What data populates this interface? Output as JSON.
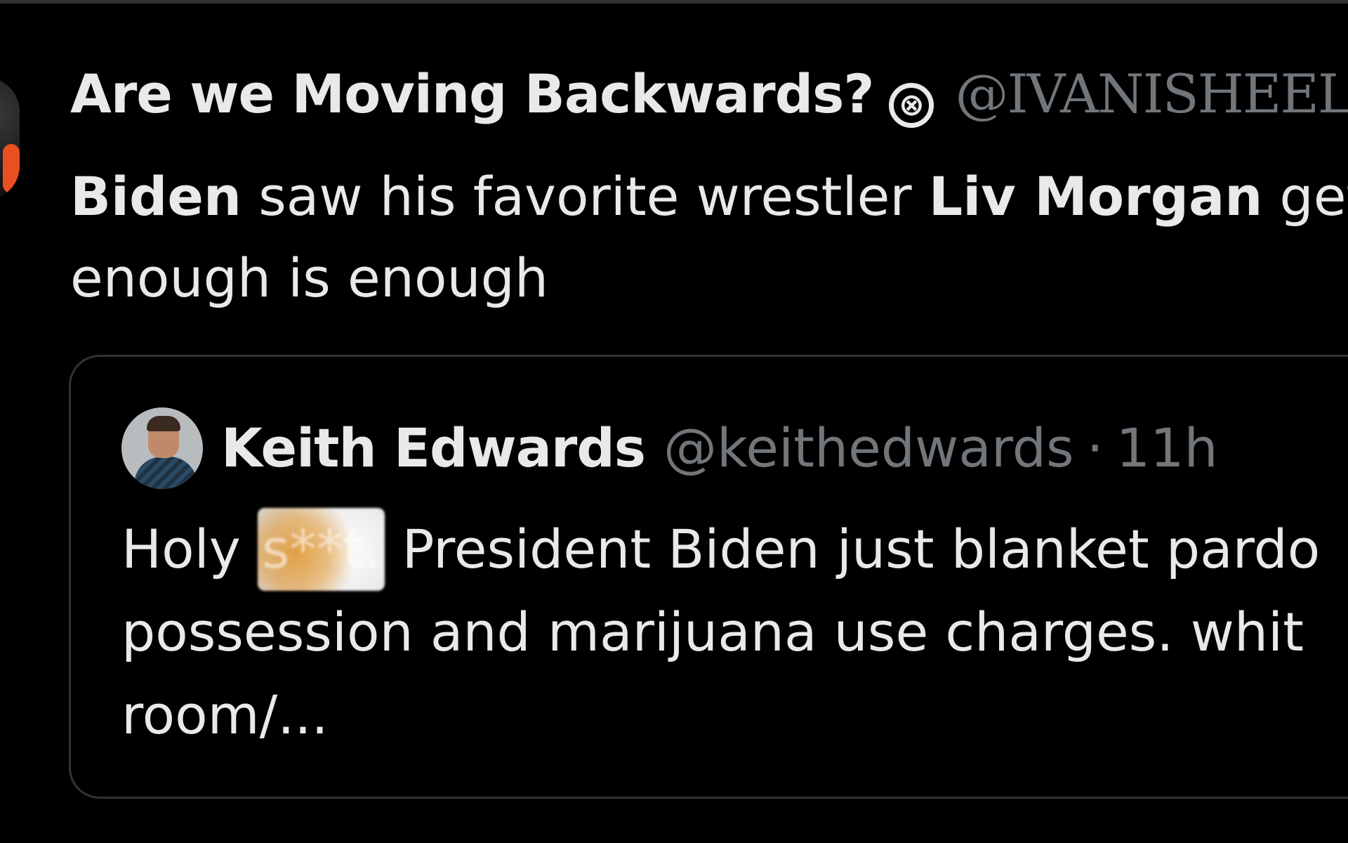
{
  "tweet": {
    "author_name": "Are we Moving Backwards?",
    "badge_symbol": "⊗",
    "author_handle": "@IVANISHEEL",
    "body_lines": [
      {
        "segments": [
          {
            "text": "Biden",
            "bold": true
          },
          {
            "text": " saw his favorite wrestler ",
            "bold": false
          },
          {
            "text": "Liv Morgan",
            "bold": true
          },
          {
            "text": " get",
            "bold": false
          }
        ]
      },
      {
        "segments": [
          {
            "text": "enough is enough",
            "bold": false
          }
        ]
      }
    ]
  },
  "quoted_tweet": {
    "author_name": "Keith Edwards",
    "author_handle": "@keithedwards",
    "separator": "·",
    "time": "11h",
    "text_line1_before": "Holy ",
    "censored_word": "s**t.",
    "text_line1_after": " President Biden just blanket pardo",
    "text_line2": "possession and marijuana use charges. whit",
    "text_line3": "room/..."
  },
  "colors": {
    "background": "#000000",
    "primary_text": "#e7e9ea",
    "secondary_text": "#71767b",
    "border": "#2f3336"
  }
}
